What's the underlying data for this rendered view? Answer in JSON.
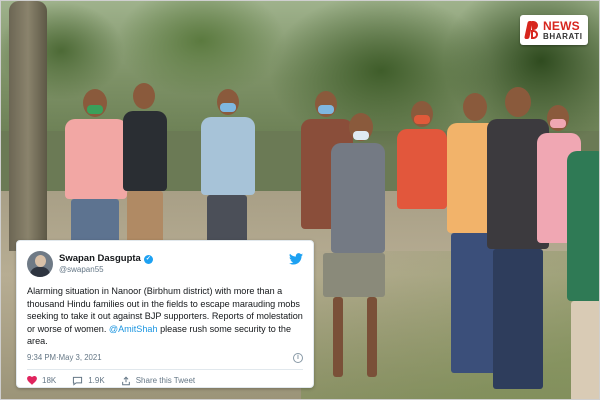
{
  "logo": {
    "top_text": "NEWS",
    "bottom_text": "BHARATI",
    "brand_color": "#d7261e"
  },
  "tweet": {
    "display_name": "Swapan Dasgupta",
    "handle": "@swapan55",
    "verified_icon": "verified-badge-icon",
    "platform_icon": "twitter-bird-icon",
    "body_part1": "Alarming situation in Nanoor (Birbhum district) with more than a thousand Hindu families out in the fields to escape marauding mobs seeking to take it out against BJP supporters. Reports of molestation or worse of women.",
    "mention": "@AmitShah",
    "body_part2": " please rush some security to the area.",
    "time": "9:34 PM",
    "separator": " · ",
    "date": "May 3, 2021",
    "info_icon": "info-icon",
    "likes_count": "18K",
    "replies_count": "1.9K",
    "share_label": "Share this Tweet",
    "accent_color": "#1da1f2",
    "like_color": "#e0245e"
  }
}
